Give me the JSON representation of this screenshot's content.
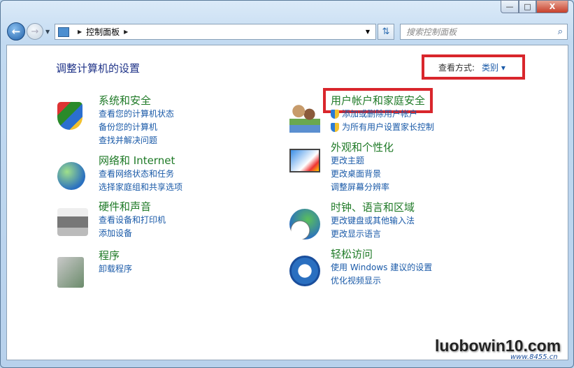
{
  "window": {
    "minimize": "—",
    "maximize": "□",
    "close": "X"
  },
  "nav": {
    "breadcrumb": "控制面板",
    "search_placeholder": "搜索控制面板"
  },
  "header": {
    "title": "调整计算机的设置",
    "view_label": "查看方式:",
    "view_value": "类别"
  },
  "colors": {
    "highlight_box": "#d9262c",
    "title_green": "#1f7a27",
    "link_blue": "#1a5aa8"
  },
  "left": [
    {
      "title": "系统和安全",
      "icon": "shield-pc-icon",
      "links": [
        "查看您的计算机状态",
        "备份您的计算机",
        "查找并解决问题"
      ]
    },
    {
      "title": "网络和 Internet",
      "icon": "network-globe-icon",
      "links": [
        "查看网络状态和任务",
        "选择家庭组和共享选项"
      ]
    },
    {
      "title": "硬件和声音",
      "icon": "printer-icon",
      "links": [
        "查看设备和打印机",
        "添加设备"
      ]
    },
    {
      "title": "程序",
      "icon": "programs-icon",
      "links": [
        "卸载程序"
      ]
    }
  ],
  "right": [
    {
      "title": "用户帐户和家庭安全",
      "icon": "users-icon",
      "links": [
        "添加或删除用户帐户",
        "为所有用户设置家长控制"
      ]
    },
    {
      "title": "外观和个性化",
      "icon": "monitor-paint-icon",
      "links": [
        "更改主题",
        "更改桌面背景",
        "调整屏幕分辨率"
      ]
    },
    {
      "title": "时钟、语言和区域",
      "icon": "clock-globe-icon",
      "links": [
        "更改键盘或其他输入法",
        "更改显示语言"
      ]
    },
    {
      "title": "轻松访问",
      "icon": "ease-of-access-icon",
      "links": [
        "使用 Windows 建议的设置",
        "优化视频显示"
      ]
    }
  ],
  "watermark": {
    "text": "luobowin10.com",
    "sub": "www.8455.cn"
  }
}
